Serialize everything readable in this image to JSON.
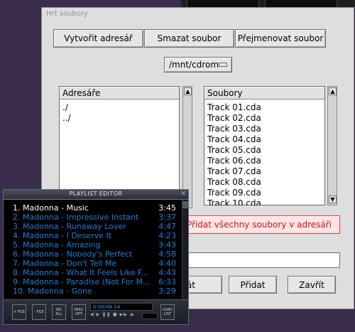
{
  "dialog": {
    "title": "Hrt soubory",
    "buttons": {
      "create_dir": "Vytvořit adresář",
      "delete_file": "Smazat soubor",
      "rename_file": "Přejmenovat soubor"
    },
    "path_selector": "/mnt/cdrom",
    "dirs_header": "Adresáře",
    "dirs": [
      "./",
      "../"
    ],
    "files_header": "Soubory",
    "files": [
      "Track 01.cda",
      "Track 02.cda",
      "Track 03.cda",
      "Track 04.cda",
      "Track 05.cda",
      "Track 06.cda",
      "Track 07.cda",
      "Track 08.cda",
      "Track 09.cda",
      "Track 10.cda"
    ],
    "add_all_button": "Přidat všechny soubory v adresáři",
    "partial_button": "rát",
    "add_button": "Přidat",
    "close_button": "Zavřít",
    "filename_value": "",
    "colors": {
      "background": "#dedede",
      "highlight_border": "#e03b3b",
      "highlight_text": "#d01010",
      "highlight_bg": "#ffe6e6"
    }
  },
  "playlist": {
    "title": "PLAYLIST EDITOR",
    "tracks": [
      {
        "num": "1.",
        "title": "Madonna - Music",
        "duration": "3:45"
      },
      {
        "num": "2.",
        "title": "Madonna - Impressive Instant",
        "duration": "3:37"
      },
      {
        "num": "3.",
        "title": "Madonna - Runaway Lover",
        "duration": "4:47"
      },
      {
        "num": "4.",
        "title": "Madonna - I Deserve It",
        "duration": "4:23"
      },
      {
        "num": "5.",
        "title": "Madonna - Amazing",
        "duration": "3:43"
      },
      {
        "num": "6.",
        "title": "Madonna - Nobody's Perfect",
        "duration": "4:58"
      },
      {
        "num": "7.",
        "title": "Madonna - Don't Tell Me",
        "duration": "4:40"
      },
      {
        "num": "8.",
        "title": "Madonna - What It Feels Like F...",
        "duration": "4:43"
      },
      {
        "num": "9.",
        "title": "Madonna - Paradise (Not For M...",
        "duration": "6:33"
      },
      {
        "num": "10.",
        "title": "Madonna - Gone",
        "duration": "3:29"
      }
    ],
    "buttons": {
      "add": "+ FILE",
      "remove": "- FILE",
      "select": "SEL ALL",
      "misc": "MISC OPT",
      "list": "LOAD LIST"
    },
    "time_display": "0:00/49:14",
    "mini_display": "-",
    "controls": "◀ ▶ ❚❚ ■ ▶▶ ⏏",
    "colors": {
      "track_text": "#1f7fd8",
      "current_track_text": "#ffffff",
      "background": "#000000"
    }
  },
  "desktop": {
    "background": "#3a2c4d"
  }
}
